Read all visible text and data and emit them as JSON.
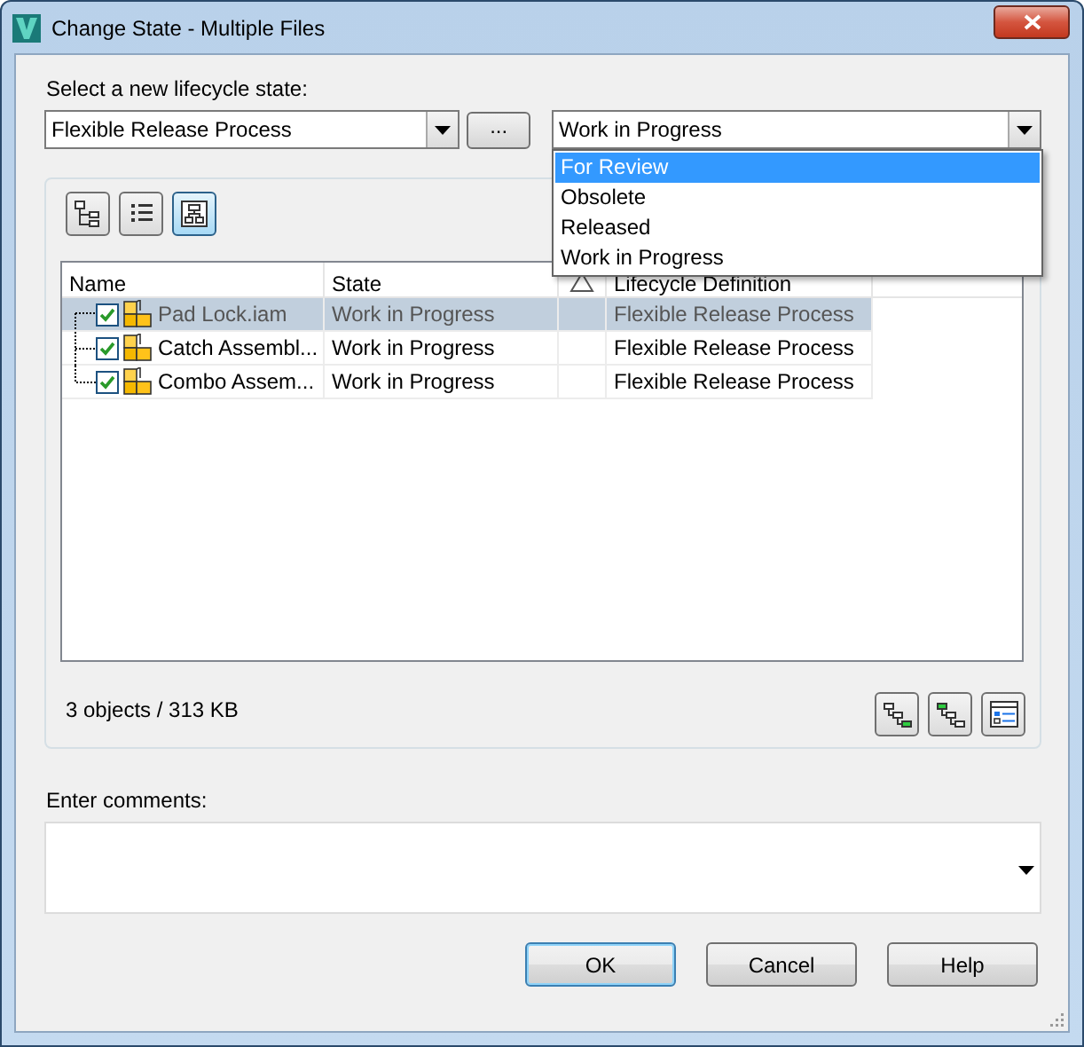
{
  "window": {
    "title": "Change State - Multiple Files"
  },
  "state_label": "Select a new lifecycle state:",
  "lifecycle_combo": {
    "value": "Flexible Release Process"
  },
  "browse_button": {
    "label": "..."
  },
  "state_combo": {
    "value": "Work in Progress",
    "expanded": true,
    "options": [
      {
        "label": "For Review",
        "highlighted": true
      },
      {
        "label": "Obsolete",
        "highlighted": false
      },
      {
        "label": "Released",
        "highlighted": false
      },
      {
        "label": "Work in Progress",
        "highlighted": false
      }
    ]
  },
  "view_buttons": [
    {
      "kind": "tree",
      "selected": false
    },
    {
      "kind": "list",
      "selected": false
    },
    {
      "kind": "hierarchy",
      "selected": true
    }
  ],
  "table": {
    "columns": [
      {
        "kind": "text",
        "label": "Name"
      },
      {
        "kind": "text",
        "label": "State"
      },
      {
        "kind": "warning"
      },
      {
        "kind": "text",
        "label": "Lifecycle Definition"
      }
    ],
    "rows": [
      {
        "name": "Pad Lock.iam",
        "state": "Work in Progress",
        "lifecycle_definition": "Flexible Release Process",
        "checked": true,
        "selected": true
      },
      {
        "name": "Catch Assembl...",
        "state": "Work in Progress",
        "lifecycle_definition": "Flexible Release Process",
        "checked": true,
        "selected": false
      },
      {
        "name": "Combo Assem...",
        "state": "Work in Progress",
        "lifecycle_definition": "Flexible Release Process",
        "checked": true,
        "selected": false
      }
    ]
  },
  "summary": "3 objects / 313 KB",
  "bottom_tools": [
    {
      "kind": "expand"
    },
    {
      "kind": "collapse"
    },
    {
      "kind": "details"
    }
  ],
  "comments": {
    "label": "Enter comments:"
  },
  "buttons": [
    {
      "label": "OK",
      "default": true
    },
    {
      "label": "Cancel",
      "default": false
    },
    {
      "label": "Help",
      "default": false
    }
  ]
}
